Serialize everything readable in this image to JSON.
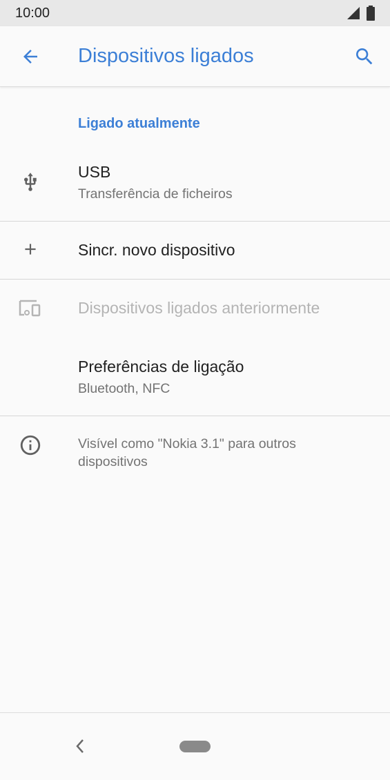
{
  "status_bar": {
    "time": "10:00"
  },
  "app_bar": {
    "title": "Dispositivos ligados"
  },
  "section": {
    "header": "Ligado atualmente"
  },
  "items": {
    "usb": {
      "title": "USB",
      "subtitle": "Transferência de ficheiros"
    },
    "pair": {
      "title": "Sincr. novo dispositivo"
    },
    "previous": {
      "title": "Dispositivos ligados anteriormente"
    },
    "prefs": {
      "title": "Preferências de ligação",
      "subtitle": "Bluetooth, NFC"
    }
  },
  "info": {
    "text": "Visível como \"Nokia 3.1\" para outros dispositivos"
  },
  "colors": {
    "accent": "#3c7fd6",
    "icon": "#616161",
    "disabled": "#b4b4b4"
  },
  "icons": [
    "arrow-back-icon",
    "search-icon",
    "usb-icon",
    "plus-icon",
    "devices-icon",
    "info-icon",
    "signal-icon",
    "battery-icon"
  ]
}
